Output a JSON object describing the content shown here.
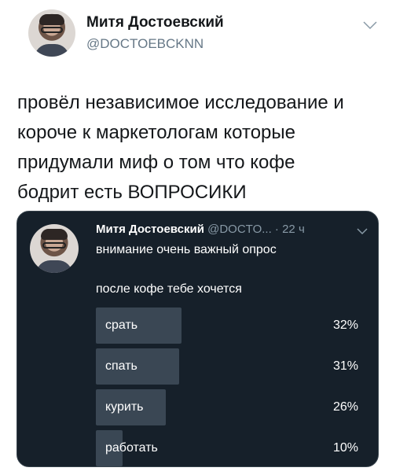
{
  "tweet": {
    "author_name": "Митя Достоевский",
    "author_handle": "@DOCTOEBCKNN",
    "text": "провёл независимое исследование и\nкороче к маркетологам которые\nпридумали миф о том что кофе\nбодрит есть ВОПРОСИКИ"
  },
  "quoted_tweet": {
    "author_name": "Митя Достоевский",
    "author_handle": "@DOCTO...",
    "separator": "·",
    "time": "22 ч",
    "line1": "внимание очень важный опрос",
    "line2": "после кофе тебе хочется",
    "poll": [
      {
        "label": "срать",
        "percent_text": "32%",
        "value": 32
      },
      {
        "label": "спать",
        "percent_text": "31%",
        "value": 31
      },
      {
        "label": "курить",
        "percent_text": "26%",
        "value": 26
      },
      {
        "label": "работать",
        "percent_text": "10%",
        "value": 10
      }
    ]
  },
  "icons": {
    "header_menu": "chevron-down-icon",
    "quoted_menu": "chevron-down-icon"
  },
  "colors": {
    "card_background": "#16202a",
    "poll_bar": "#3a4754",
    "handle_text": "#657786"
  }
}
